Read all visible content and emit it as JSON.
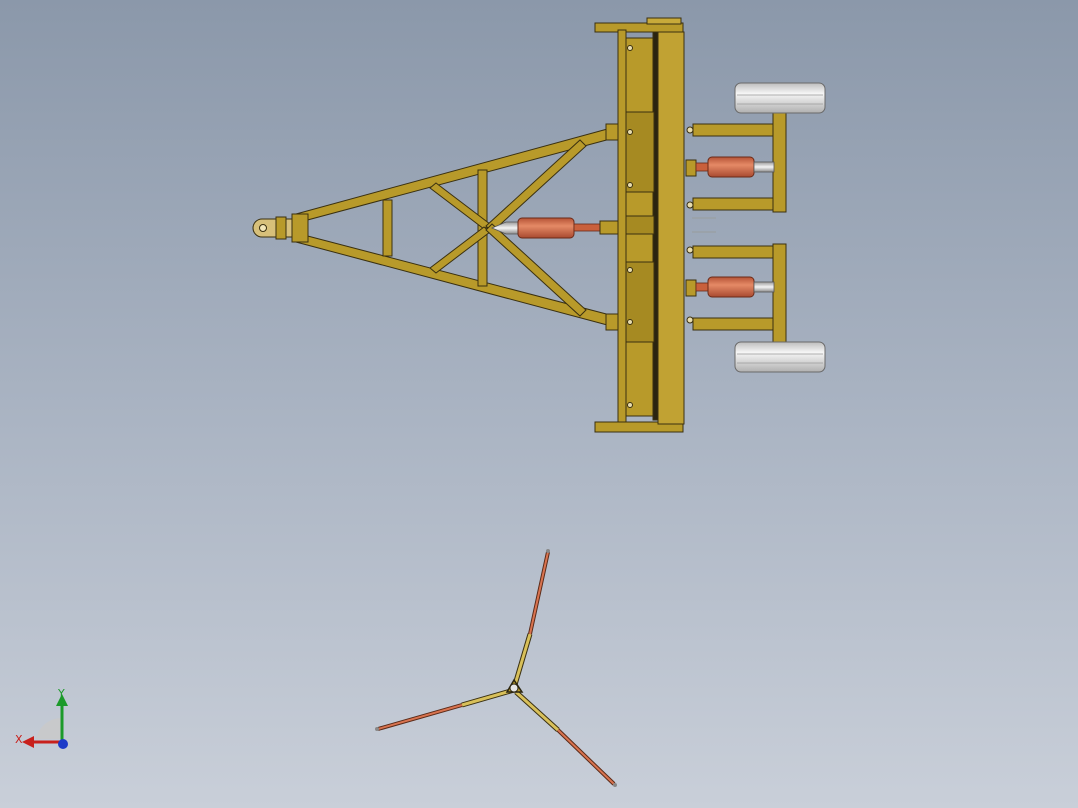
{
  "view": {
    "background_top": "#8b98aa",
    "background_bottom": "#c9cfd9",
    "frame_color": "#b89a2a",
    "frame_edge_color": "#3a3010",
    "cylinder_color": "#d9734f",
    "rod_color": "#e8e8e8",
    "wheel_color": "#ececec"
  },
  "triad": {
    "x_label": "X",
    "y_label": "Y",
    "x_color": "#c8201c",
    "y_color": "#1c9a2a",
    "z_color": "#1c3ac8"
  },
  "scene": {
    "model_items": [
      {
        "name": "hitch-eye"
      },
      {
        "name": "tow-triangle"
      },
      {
        "name": "main-cylinder"
      },
      {
        "name": "main-beam"
      },
      {
        "name": "wheel-arm-upper"
      },
      {
        "name": "wheel-arm-lower"
      },
      {
        "name": "wheel-cylinder-upper"
      },
      {
        "name": "wheel-cylinder-lower"
      },
      {
        "name": "wheel-upper"
      },
      {
        "name": "wheel-lower"
      },
      {
        "name": "three-arm-linkage"
      }
    ]
  }
}
